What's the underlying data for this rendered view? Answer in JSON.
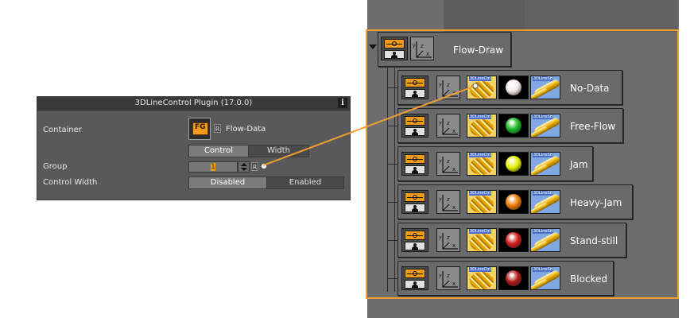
{
  "plugin_panel": {
    "title": "3DLineControl Plugin (17.0.0)",
    "info_label": "i",
    "container_label": "Container",
    "container_icon_text": "FG",
    "container_r": "R",
    "container_name": "Flow-Data",
    "tab_control": "Control",
    "tab_width": "Width",
    "group_label": "Group",
    "group_value": "1",
    "group_r": "R",
    "control_width_label": "Control Width",
    "option_disabled": "Disabled",
    "option_enabled": "Enabled"
  },
  "tree": {
    "root": {
      "label": "Flow-Draw"
    },
    "thumb_ctrl_label": "3DLineCtrl",
    "thumb_sh_label": "3DLineSH",
    "children": [
      {
        "label": "No-Data",
        "color": "#f4e8e8"
      },
      {
        "label": "Free-Flow",
        "color": "#17b81f"
      },
      {
        "label": "Jam",
        "color": "#e6ee00"
      },
      {
        "label": "Heavy-Jam",
        "color": "#ee7a00"
      },
      {
        "label": "Stand-still",
        "color": "#d21a1a"
      },
      {
        "label": "Blocked",
        "color": "#b01616"
      }
    ]
  },
  "colors": {
    "highlight": "#f0a030",
    "panel_bg": "#595959",
    "tree_bg": "#6d6d6d"
  }
}
